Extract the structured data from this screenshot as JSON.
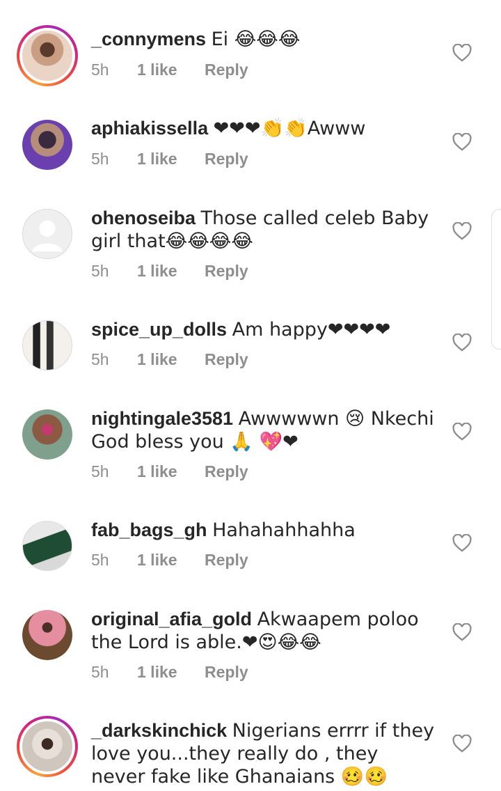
{
  "comments": [
    {
      "username": "_connymens",
      "text": "Ei 😂😂😂",
      "time": "5h",
      "likes": "1 like",
      "reply": "Reply",
      "story": true,
      "avatar": "person-photo"
    },
    {
      "username": "aphiakissella",
      "text": "❤❤❤👏👏Awww",
      "time": "5h",
      "likes": "1 like",
      "reply": "Reply",
      "story": false,
      "avatar": "person-photo"
    },
    {
      "username": "ohenoseiba",
      "text": "Those called celeb Baby girl that😂😂😂😂",
      "time": "5h",
      "likes": "1 like",
      "reply": "Reply",
      "story": false,
      "avatar": "default-avatar"
    },
    {
      "username": "spice_up_dolls",
      "text": "Am happy❤❤❤❤",
      "time": "5h",
      "likes": "1 like",
      "reply": "Reply",
      "story": false,
      "avatar": "product-photo"
    },
    {
      "username": "nightingale3581",
      "text": "Awwwwwn 😢 Nkechi God bless you 🙏 💖❤",
      "time": "5h",
      "likes": "1 like",
      "reply": "Reply",
      "story": false,
      "avatar": "person-photo"
    },
    {
      "username": "fab_bags_gh",
      "text": "Hahahahhahha",
      "time": "5h",
      "likes": "1 like",
      "reply": "Reply",
      "story": false,
      "avatar": "bag-photo"
    },
    {
      "username": "original_afia_gold",
      "text": "Akwaapem poloo the Lord is able.❤😍😂😂",
      "time": "5h",
      "likes": "1 like",
      "reply": "Reply",
      "story": false,
      "avatar": "person-photo"
    },
    {
      "username": "_darkskinchick",
      "text": "Nigerians errrr if they love you...they really do , they never fake like Ghanaians 🥴🥴",
      "time": "",
      "likes": "",
      "reply": "",
      "story": true,
      "avatar": "person-photo"
    }
  ],
  "icons": {
    "like": "heart-outline-icon"
  },
  "colors": {
    "text": "#262626",
    "meta": "#8e8e8e",
    "ring": "#d3227e"
  }
}
